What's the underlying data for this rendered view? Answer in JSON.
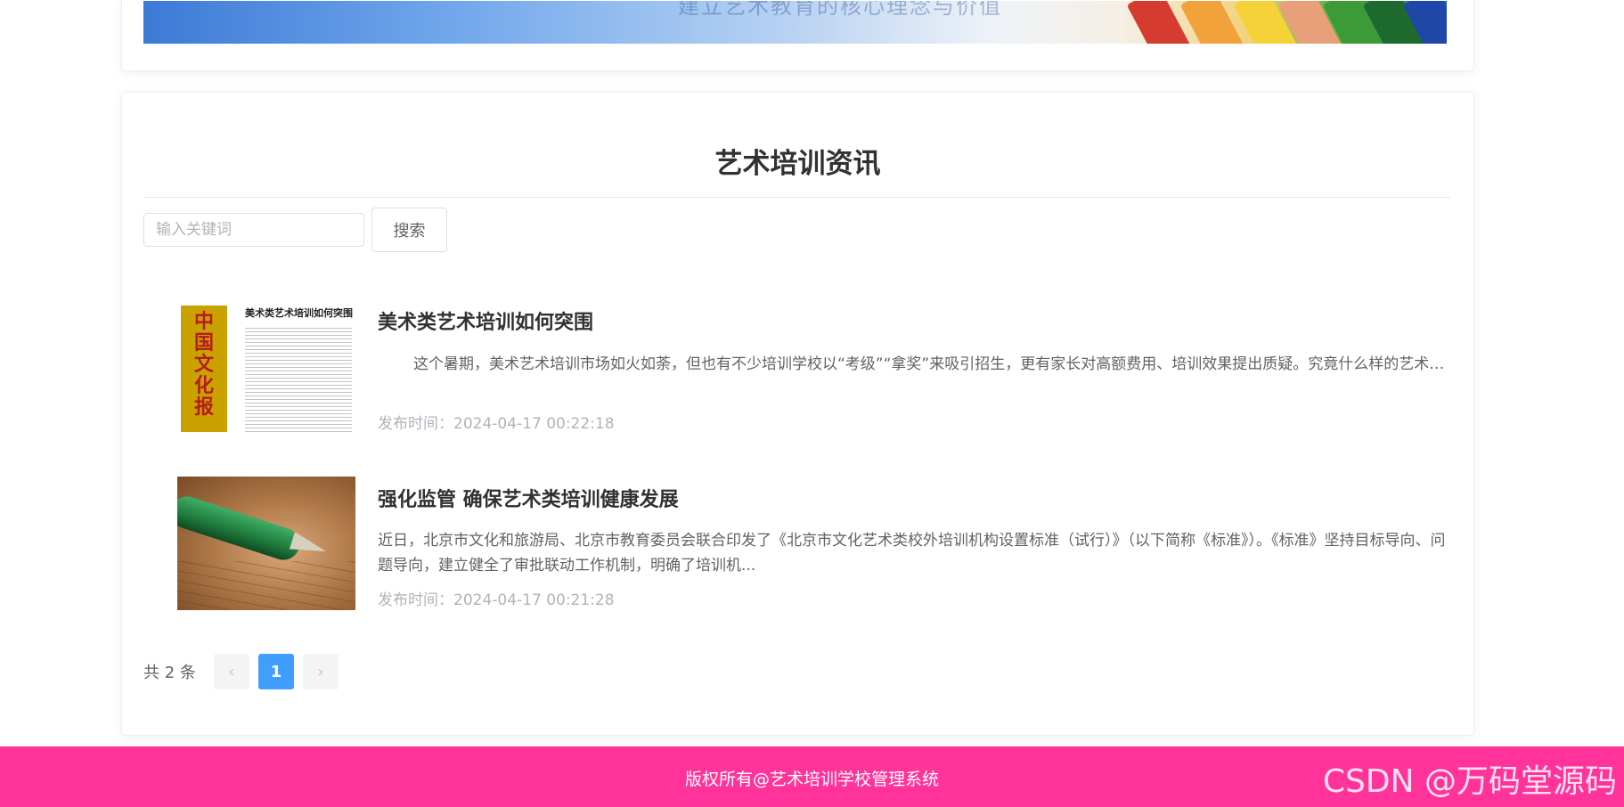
{
  "banner": {
    "caption": "建立艺术教育的核心理念与价值"
  },
  "news_section": {
    "title": "艺术培训资讯",
    "search": {
      "placeholder": "输入关键词",
      "button_label": "搜索"
    },
    "items": [
      {
        "title": "美术类艺术培训如何突围",
        "summary": "这个暑期，美术艺术培训市场如火如荼，但也有不少培训学校以“考级”“拿奖”来吸引招生，更有家长对高额费用、培训效果提出质疑。究竟什么样的艺术培训...",
        "time": "发布时间：2024-04-17 00:22:18",
        "thumb_masthead": "中国文化报",
        "thumb_headline": "美术类艺术培训如何突围"
      },
      {
        "title": "强化监管 确保艺术类培训健康发展",
        "summary": "近日，北京市文化和旅游局、北京市教育委员会联合印发了《北京市文化艺术类校外培训机构设置标准（试行）》（以下简称《标准》）。《标准》坚持目标导向、问题导向，建立健全了审批联动工作机制，明确了培训机...",
        "time": "发布时间：2024-04-17 00:21:28"
      }
    ],
    "pagination": {
      "total": "共 2 条",
      "prev_icon": "chevron-left-icon",
      "prev_glyph": "‹",
      "current_page": "1",
      "next_icon": "chevron-right-icon",
      "next_glyph": "›"
    }
  },
  "footer": {
    "copyright": "版权所有@艺术培训学校管理系统",
    "watermark": "CSDN @万码堂源码"
  },
  "colors": {
    "footer_bg": "#ff3399",
    "active_page": "#409eff"
  }
}
